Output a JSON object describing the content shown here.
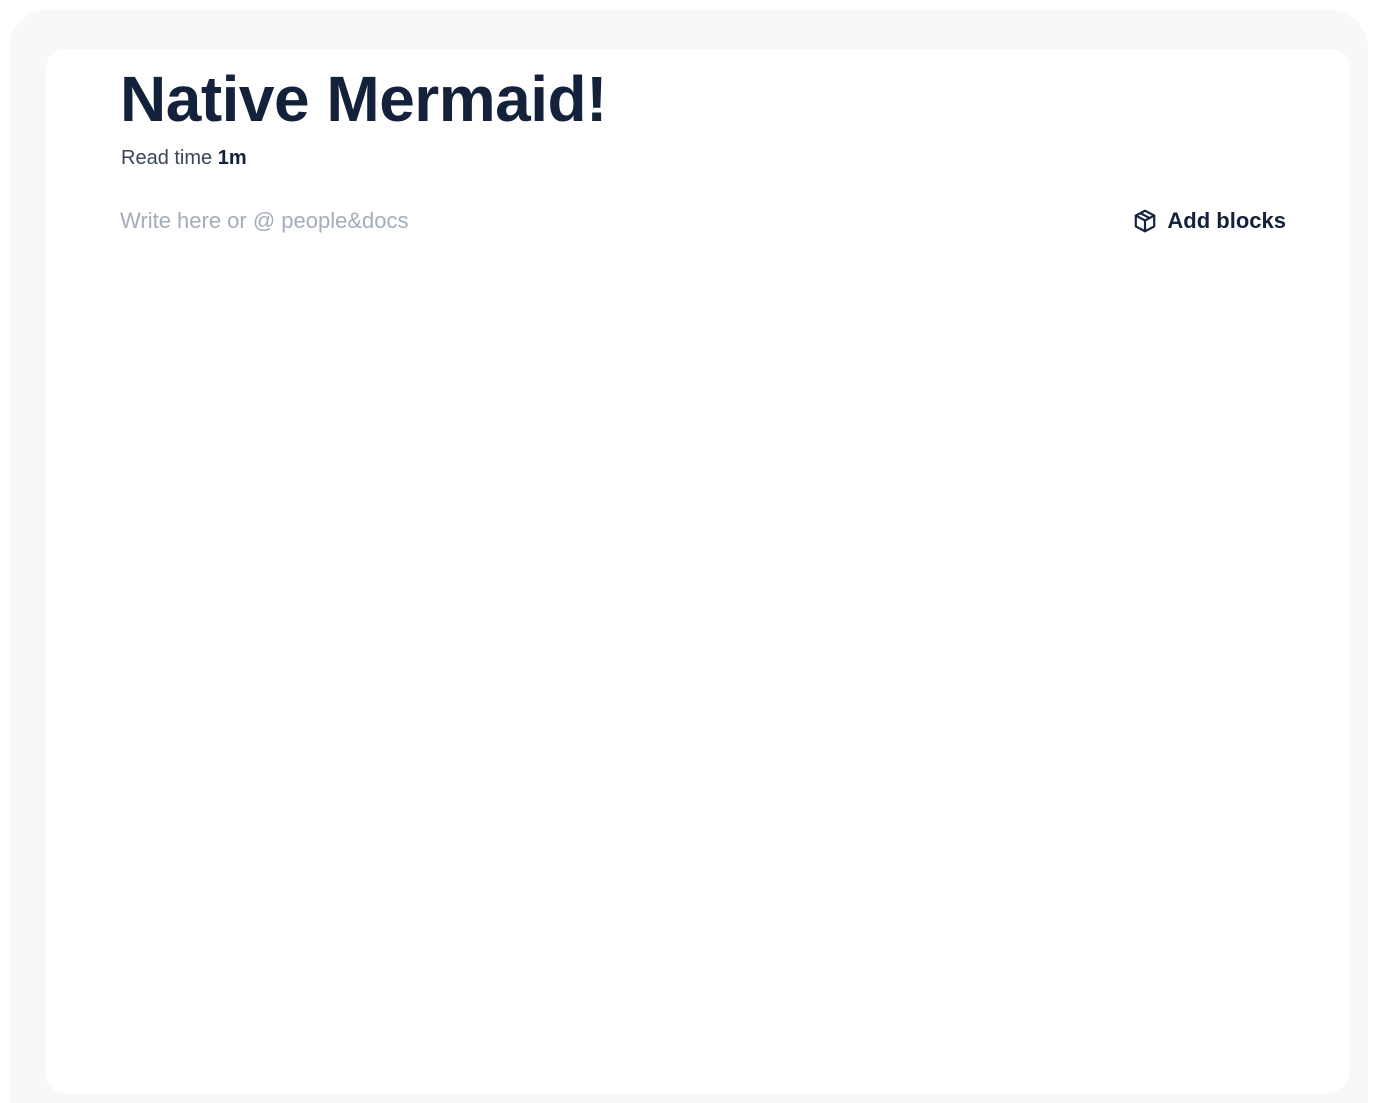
{
  "document": {
    "title": "Native Mermaid!",
    "read_time_label": "Read time",
    "read_time_value": "1m"
  },
  "editor": {
    "placeholder": "Write here or @ people&docs",
    "value": ""
  },
  "toolbar": {
    "add_blocks_label": "Add blocks",
    "add_blocks_icon": "cube-icon"
  },
  "colors": {
    "text_primary": "#14213a",
    "placeholder": "#a3adb9",
    "frame_background": "#f7f8f8",
    "card_background": "#ffffff"
  }
}
